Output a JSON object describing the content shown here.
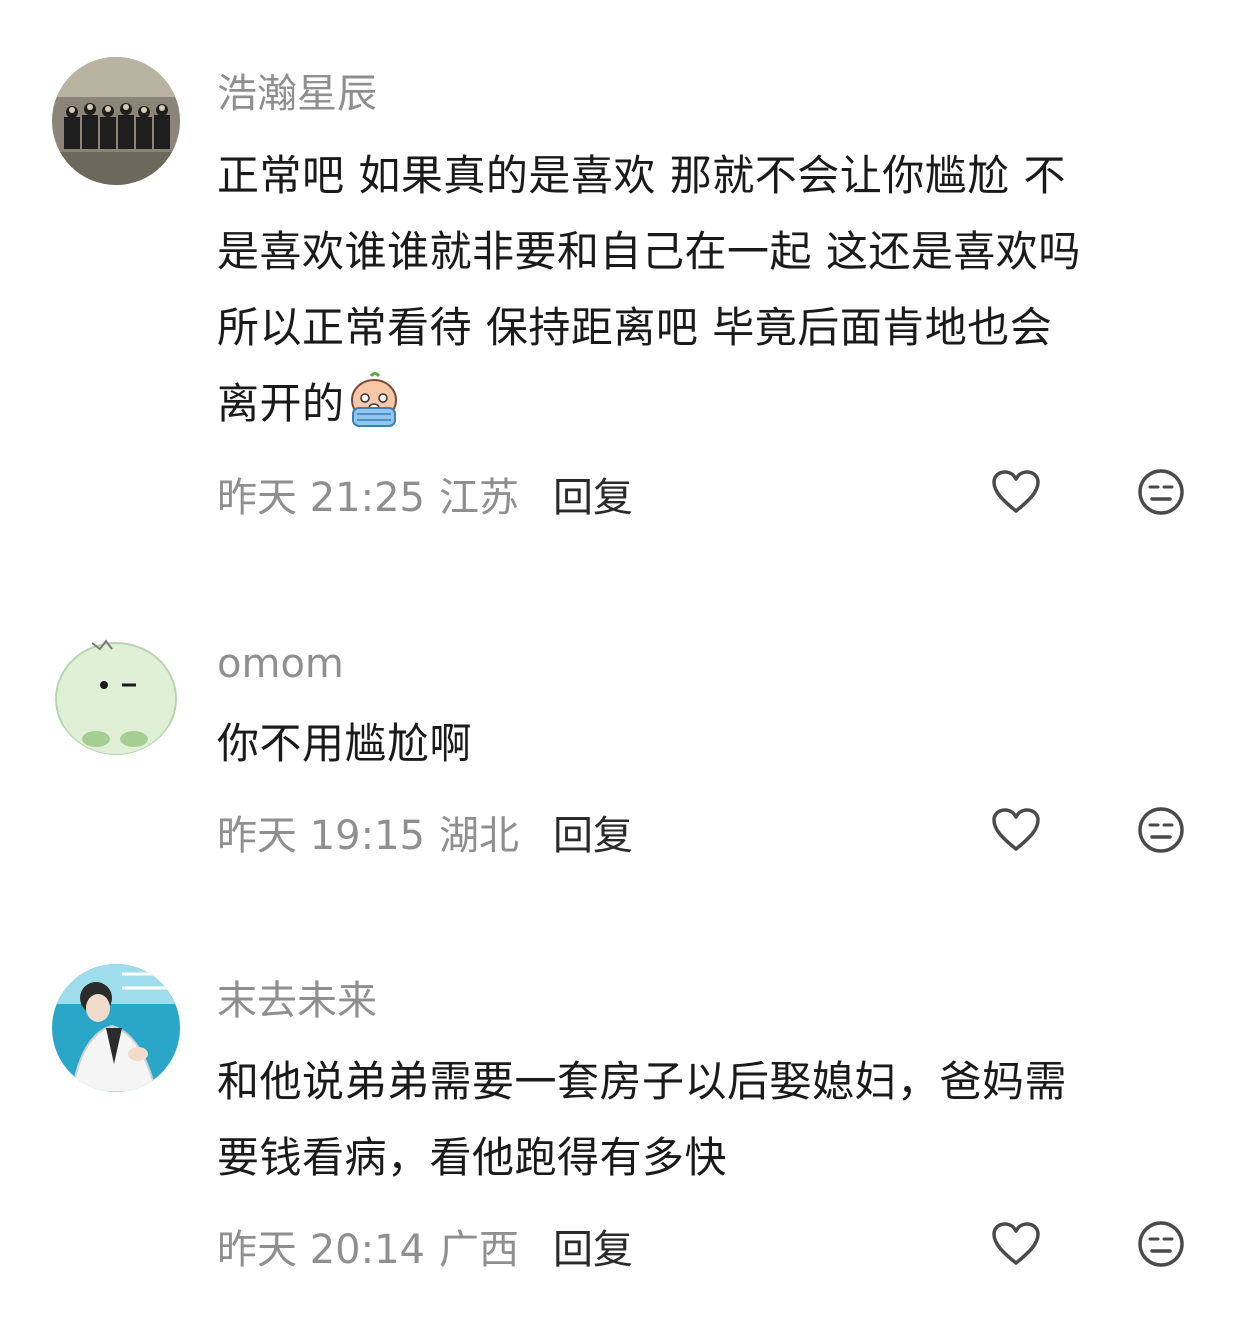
{
  "comments": [
    {
      "username": "浩瀚星辰",
      "text_lines": [
        "正常吧 如果真的是喜欢 那就不会让你尴尬 不",
        "是喜欢谁谁就非要和自己在一起 这还是喜欢吗",
        "所以正常看待 保持距离吧 毕竟后面肯地也会",
        "离开的"
      ],
      "emoji": "crying-face-emoji",
      "time": "昨天 21:25",
      "location": "江苏",
      "reply_label": "回复"
    },
    {
      "username": "omom",
      "text_lines": [
        "你不用尴尬啊"
      ],
      "time": "昨天 19:15",
      "location": "湖北",
      "reply_label": "回复"
    },
    {
      "username": "末去未来",
      "text_lines": [
        "和他说弟弟需要一套房子以后娶媳妇，爸妈需",
        "要钱看病，看他跑得有多快"
      ],
      "time": "昨天 20:14",
      "location": "广西",
      "reply_label": "回复"
    }
  ],
  "icons": {
    "like": "heart-outline-icon",
    "dislike": "meh-face-icon"
  },
  "colors": {
    "username": "#8f8f8f",
    "text": "#1a1a1a",
    "meta": "#8f8f8f",
    "reply": "#2a2a2a",
    "icon": "#4a4a4a"
  }
}
